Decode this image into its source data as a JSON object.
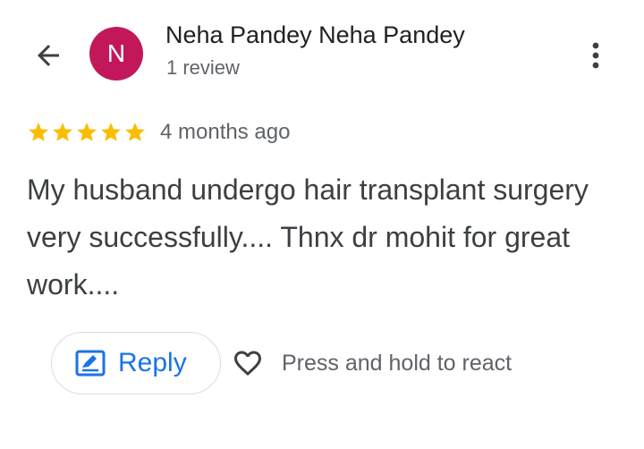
{
  "header": {
    "avatar_letter": "N",
    "reviewer_name": "Neha Pandey Neha Pandey",
    "review_count": "1 review"
  },
  "review": {
    "rating": 5,
    "max_rating": 5,
    "time_ago": "4 months ago",
    "text": "My husband undergo hair transplant surgery very successfully.... Thnx dr mohit for great work...."
  },
  "actions": {
    "reply_label": "Reply",
    "react_hint": "Press and hold to react"
  },
  "icons": {
    "back": "arrow-back-icon",
    "more": "more-vert-icon",
    "star": "star-icon",
    "reply": "reply-edit-icon",
    "heart": "heart-outline-icon"
  },
  "colors": {
    "avatar_bg": "#c2185b",
    "star": "#fbbc04",
    "reply_accent": "#1a73e8",
    "secondary_text": "#5f6368"
  }
}
